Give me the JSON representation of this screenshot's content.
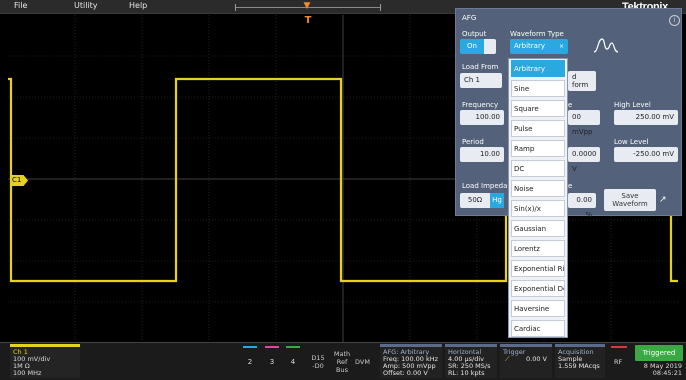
{
  "menu": {
    "file": "File",
    "utility": "Utility",
    "help": "Help"
  },
  "brand": {
    "logo": "Tektronix",
    "help_icon": "i"
  },
  "trigger_marker": "T",
  "ch1_marker_label": "C1",
  "colors": {
    "ch1": "#e6d21a",
    "accent": "#2aa8e0",
    "panel": "#53617a",
    "triggered": "#3aa944",
    "trigger": "#f08a24"
  },
  "afg": {
    "title": "AFG",
    "output_label": "Output",
    "output_on": "On",
    "waveform_type_label": "Waveform Type",
    "waveform_selected": "Arbitrary",
    "load_from_label": "Load From",
    "load_from_value": "Ch 1",
    "load_waveform_tail": [
      "d",
      "form"
    ],
    "frequency_label": "Frequency",
    "frequency_value": "100.00",
    "amplitude_tail": "e",
    "amplitude_value_tail": "00 mVpp",
    "high_level_label": "High Level",
    "high_level_value": "250.00 mV",
    "period_label": "Period",
    "period_value": "10.00",
    "offset_value_tail": "0.0000 V",
    "low_level_label": "Low Level",
    "low_level_value": "-250.00 mV",
    "load_impedance_label": "Load Impedanc",
    "imp_50": "50Ω",
    "imp_hi": "Hg",
    "symmetry_tail": "e",
    "symmetry_value": "0.00 %",
    "save_waveform": [
      "Save",
      "Waveform"
    ],
    "waveform_options": [
      "Arbitrary",
      "Sine",
      "Square",
      "Pulse",
      "Ramp",
      "DC",
      "Noise",
      "Sin(x)/x",
      "Gaussian",
      "Lorentz",
      "Exponential Rise",
      "Exponential Deca",
      "Haversine",
      "Cardiac"
    ]
  },
  "bottom": {
    "ch1": {
      "title": "Ch 1",
      "scale": "100 mV/div",
      "impedance": "1M Ω",
      "bandwidth": "100 MHz"
    },
    "channels": [
      "2",
      "3",
      "4"
    ],
    "dig": [
      "D15",
      "-D0"
    ],
    "math_ref_bus": [
      "Math",
      "Ref",
      "Bus"
    ],
    "dvm": "DVM",
    "afg_info": {
      "title": "AFG: Arbitrary",
      "freq": "Freq: 100.00 kHz",
      "amp": "Amp: 500 mVpp",
      "offset": "Offset: 0.00 V"
    },
    "horizontal": {
      "title": "Horizontal",
      "scale": "4.00 µs/div",
      "sr": "SR: 250 MS/s",
      "rl": "RL: 10 kpts"
    },
    "trigger": {
      "title": "Trigger",
      "level": "0.00 V"
    },
    "acquisition": {
      "title": "Acquisition",
      "mode": "Sample",
      "count": "1.559 MAcqs"
    },
    "rf": "RF",
    "status": "Triggered",
    "date": "8 May 2019",
    "time": "08:45:21"
  }
}
